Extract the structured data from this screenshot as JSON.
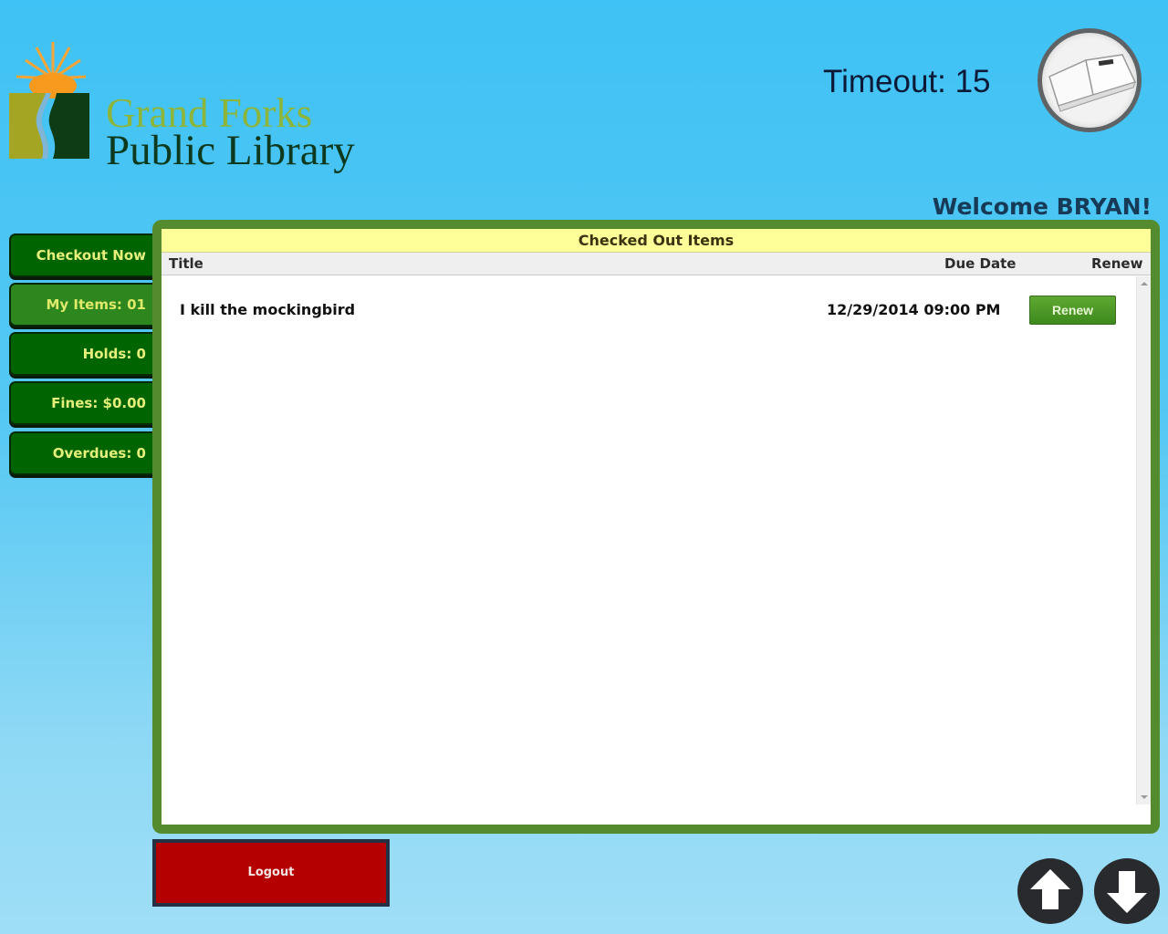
{
  "header": {
    "logo_line1": "Grand Forks",
    "logo_line2": "Public Library",
    "timeout_label": "Timeout: 15",
    "welcome": "Welcome BRYAN!"
  },
  "sidebar": {
    "items": [
      {
        "label": "Checkout Now",
        "active": false
      },
      {
        "label": "My Items: 01",
        "active": true
      },
      {
        "label": "Holds: 0",
        "active": false
      },
      {
        "label": "Fines: $0.00",
        "active": false
      },
      {
        "label": "Overdues: 0",
        "active": false
      }
    ]
  },
  "panel": {
    "title": "Checked Out Items",
    "columns": [
      "Title",
      "Due Date",
      "Renew"
    ],
    "rows": [
      {
        "title": "I kill the mockingbird",
        "due_date": "12/29/2014 09:00 PM",
        "renew_label": "Renew"
      }
    ]
  },
  "footer": {
    "logout_label": "Logout",
    "scroll_up_icon": "arrow-up-icon",
    "scroll_down_icon": "arrow-down-icon"
  },
  "colors": {
    "panel_border": "#558b2f",
    "title_bar": "#ffff99",
    "sidebar_button": "#006400",
    "sidebar_active": "#2d861e",
    "logout": "#b50000"
  }
}
